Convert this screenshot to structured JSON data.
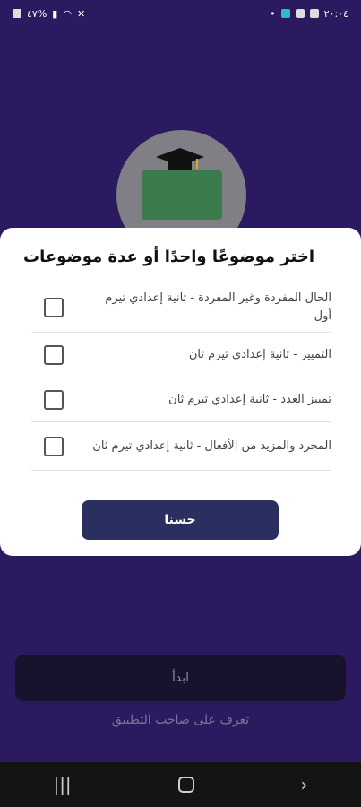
{
  "status_bar": {
    "time": "٢٠:٠٤",
    "battery": "٤٧%"
  },
  "background_screen": {
    "start_button": "ابدأ",
    "owner_link": "تعرف على صاحب التطبيق"
  },
  "dialog": {
    "title": "اختر موضوعًا واحدًا أو عدة موضوعات",
    "items": [
      {
        "label": "الحال المفردة وغير المفردة - ثانية إعدادي تيرم أول"
      },
      {
        "label": "التمييز - ثانية إعدادي تيرم ثان"
      },
      {
        "label": "تمييز العدد - ثانية إعدادي تيرم ثان"
      },
      {
        "label": "المجرد والمزيد من الأفعال - ثانية إعدادي تيرم ثان"
      }
    ],
    "ok_button": "حسنا"
  },
  "nav_bar": {
    "recent_icon": "|||",
    "back_icon": "›"
  }
}
